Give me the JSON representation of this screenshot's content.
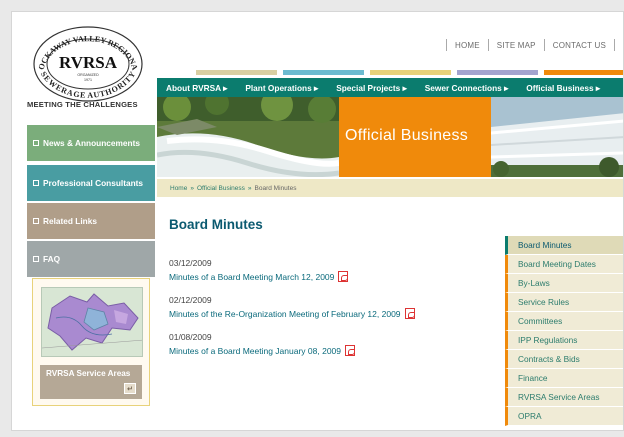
{
  "logo": {
    "line1": "ROCKAWAY VALLEY REGIONAL",
    "abbr": "RVRSA",
    "organized": "ORGANIZED",
    "year": "1971",
    "line2": "SEWERAGE AUTHORITY"
  },
  "top_links": [
    "HOME",
    "SITE MAP",
    "CONTACT US"
  ],
  "stripe_colors": [
    "#d9cfa2",
    "#6cbbd0",
    "#e8d27a",
    "#a3a4cf",
    "#f08a0b"
  ],
  "nav": {
    "items": [
      "About RVRSA ▸",
      "Plant Operations ▸",
      "Special Projects ▸",
      "Sewer Connections ▸",
      "Official Business ▸"
    ]
  },
  "left": {
    "heading": "MEETING THE CHALLENGES",
    "buttons": [
      {
        "label": "News & Announcements",
        "color": "#7bad7b"
      },
      {
        "label": "Professional Consultants",
        "color": "#499da2"
      },
      {
        "label": "Related Links",
        "color": "#b09e89"
      },
      {
        "label": "FAQ",
        "color": "#9fa7a8"
      }
    ],
    "map_caption": "RVRSA Service Areas",
    "map_arrow": "↵"
  },
  "hero": {
    "title": "Official Business"
  },
  "breadcrumb": {
    "items": [
      "Home",
      "Official Business",
      "Board Minutes"
    ],
    "sep": "»"
  },
  "main": {
    "title": "Board Minutes",
    "entries": [
      {
        "date": "03/12/2009",
        "text": "Minutes of a Board Meeting March 12, 2009"
      },
      {
        "date": "02/12/2009",
        "text": "Minutes of the Re-Organization Meeting of February 12, 2009"
      },
      {
        "date": "01/08/2009",
        "text": "Minutes of a Board Meeting January 08, 2009"
      }
    ]
  },
  "subnav": {
    "items": [
      "Board Minutes",
      "Board Meeting Dates",
      "By-Laws",
      "Service Rules",
      "Committees",
      "IPP Regulations",
      "Contracts & Bids",
      "Finance",
      "RVRSA Service Areas",
      "OPRA"
    ],
    "active": 0
  },
  "colors": {
    "brand_green": "#0b7c6e",
    "orange": "#f08a0b",
    "crumb_bg": "#eee8c6",
    "link": "#0b6a7c"
  }
}
